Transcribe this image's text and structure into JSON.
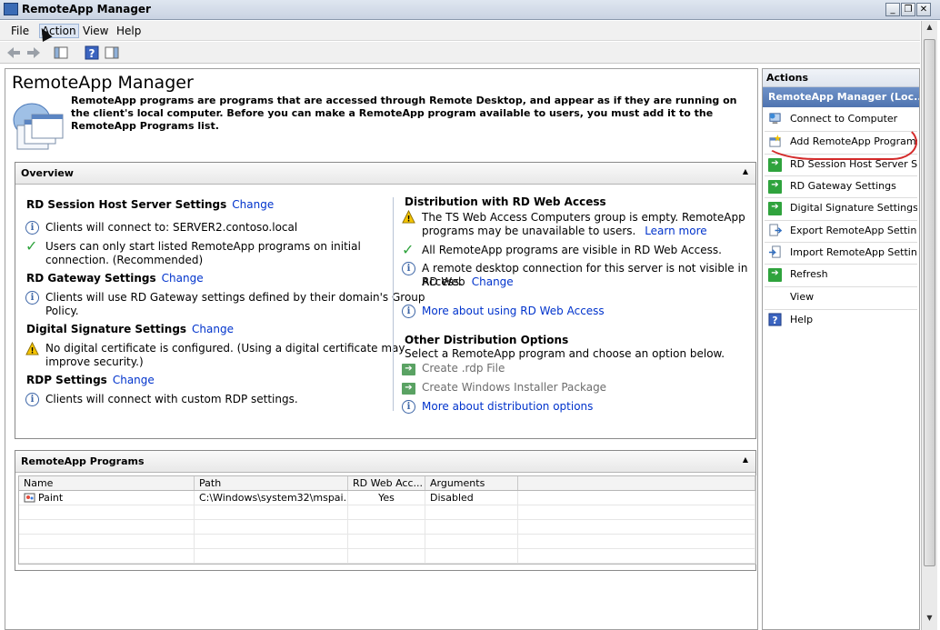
{
  "window": {
    "title": "RemoteApp Manager"
  },
  "menu": {
    "file": "File",
    "action": "Action",
    "view": "View",
    "help": "Help"
  },
  "main": {
    "title": "RemoteApp Manager",
    "intro": "RemoteApp programs are programs that are accessed through Remote Desktop, and appear as if they are running on the client's local computer. Before you can make a RemoteApp program available to users, you must add it to the RemoteApp Programs list."
  },
  "overview": {
    "header": "Overview",
    "change_label": "Change",
    "rdsh": {
      "title": "RD Session Host Server Settings",
      "line1": "Clients will connect to: SERVER2.contoso.local",
      "line2a": "Users can only start listed RemoteApp programs on initial",
      "line2b": "connection. (Recommended)"
    },
    "gateway": {
      "title": "RD Gateway Settings",
      "line1a": "Clients will use RD Gateway settings defined by their domain's Group",
      "line1b": "Policy."
    },
    "signature": {
      "title": "Digital Signature Settings",
      "line1a": "No digital certificate is configured. (Using a digital certificate may",
      "line1b": "improve security.)"
    },
    "rdp": {
      "title": "RDP Settings",
      "line1": "Clients will connect with custom RDP settings."
    },
    "webaccess": {
      "title": "Distribution with RD Web Access",
      "line1a": "The TS Web Access Computers group is empty. RemoteApp",
      "line1b": "programs may be unavailable to users.",
      "learn_more": "Learn more",
      "line2": "All RemoteApp programs are visible in RD Web Access.",
      "line3a": "A remote desktop connection for this server is not visible in RD Web",
      "line3b": "Access.",
      "more_link": "More about using RD Web Access"
    },
    "other": {
      "title": "Other Distribution Options",
      "desc": "Select a RemoteApp program and choose an option below.",
      "opt1": "Create .rdp File",
      "opt2": "Create Windows Installer Package",
      "more_link": "More about distribution options"
    }
  },
  "programs": {
    "header": "RemoteApp Programs",
    "columns": [
      "Name",
      "Path",
      "RD Web Acc...",
      "Arguments"
    ],
    "rows": [
      {
        "name": "Paint",
        "path": "C:\\Windows\\system32\\mspai...",
        "web": "Yes",
        "args": "Disabled"
      }
    ]
  },
  "actions": {
    "header": "Actions",
    "subheader": "RemoteApp Manager (Loc...",
    "items": [
      {
        "label": "Connect to Computer",
        "icon": "computer-icon"
      },
      {
        "label": "Add RemoteApp Programs",
        "icon": "add-programs-icon"
      },
      {
        "label": "RD Session Host Server S...",
        "icon": "green-arrow-icon"
      },
      {
        "label": "RD Gateway Settings",
        "icon": "green-arrow-icon"
      },
      {
        "label": "Digital Signature Settings",
        "icon": "green-arrow-icon"
      },
      {
        "label": "Export RemoteApp Settings",
        "icon": "export-icon"
      },
      {
        "label": "Import RemoteApp Settings",
        "icon": "import-icon"
      },
      {
        "label": "Refresh",
        "icon": "green-arrow-icon"
      },
      {
        "label": "View",
        "icon": ""
      },
      {
        "label": "Help",
        "icon": "help-icon"
      }
    ]
  }
}
